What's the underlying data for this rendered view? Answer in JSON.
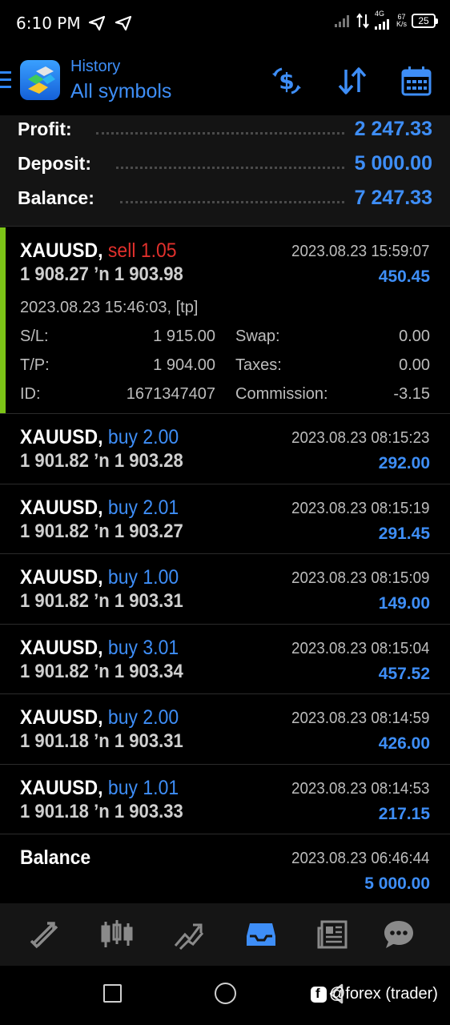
{
  "status_bar": {
    "time": "6:10 PM",
    "net_speed": "67",
    "net_unit": "K/s",
    "network_type": "4G",
    "battery": "25"
  },
  "header": {
    "title": "History",
    "subtitle": "All symbols",
    "icons": [
      "logo-icon",
      "dollar-swap-icon",
      "sort-icon",
      "calendar-icon"
    ]
  },
  "summary": {
    "profit_label": "Profit:",
    "profit_value": "2 247.33",
    "deposit_label": "Deposit:",
    "deposit_value": "5 000.00",
    "balance_label": "Balance:",
    "balance_value": "7 247.33"
  },
  "trades": [
    {
      "symbol": "XAUUSD,",
      "direction": "sell 1.05",
      "prices": "1 908.27 ’n  1 903.98",
      "time": "2023.08.23 15:59:07",
      "profit": "450.45",
      "details": {
        "open_time": "2023.08.23 15:46:03, [tp]",
        "sl_label": "S/L:",
        "sl_value": "1 915.00",
        "tp_label": "T/P:",
        "tp_value": "1 904.00",
        "id_label": "ID:",
        "id_value": "1671347407",
        "swap_label": "Swap:",
        "swap_value": "0.00",
        "taxes_label": "Taxes:",
        "taxes_value": "0.00",
        "commission_label": "Commission:",
        "commission_value": "-3.15"
      }
    },
    {
      "symbol": "XAUUSD,",
      "direction": "buy 2.00",
      "prices": "1 901.82 ’n  1 903.28",
      "time": "2023.08.23 08:15:23",
      "profit": "292.00"
    },
    {
      "symbol": "XAUUSD,",
      "direction": "buy 2.01",
      "prices": "1 901.82 ’n  1 903.27",
      "time": "2023.08.23 08:15:19",
      "profit": "291.45"
    },
    {
      "symbol": "XAUUSD,",
      "direction": "buy 1.00",
      "prices": "1 901.82 ’n  1 903.31",
      "time": "2023.08.23 08:15:09",
      "profit": "149.00"
    },
    {
      "symbol": "XAUUSD,",
      "direction": "buy 3.01",
      "prices": "1 901.82 ’n  1 903.34",
      "time": "2023.08.23 08:15:04",
      "profit": "457.52"
    },
    {
      "symbol": "XAUUSD,",
      "direction": "buy 2.00",
      "prices": "1 901.18 ’n  1 903.31",
      "time": "2023.08.23 08:14:59",
      "profit": "426.00"
    },
    {
      "symbol": "XAUUSD,",
      "direction": "buy 1.01",
      "prices": "1 901.18 ’n  1 903.33",
      "time": "2023.08.23 08:14:53",
      "profit": "217.15"
    }
  ],
  "balance_entry": {
    "label": "Balance",
    "time": "2023.08.23 06:46:44",
    "amount": "5 000.00"
  },
  "bottom_nav": {
    "items": [
      "quotes-icon",
      "chart-icon",
      "trade-icon",
      "history-icon",
      "news-icon",
      "chat-icon"
    ],
    "active": "history-icon"
  },
  "watermark": "@forex (trader)",
  "colors": {
    "accent_blue": "#3e8ef7",
    "sell_red": "#e0302c",
    "selected_bar": "#7cc417",
    "background": "#000000"
  }
}
